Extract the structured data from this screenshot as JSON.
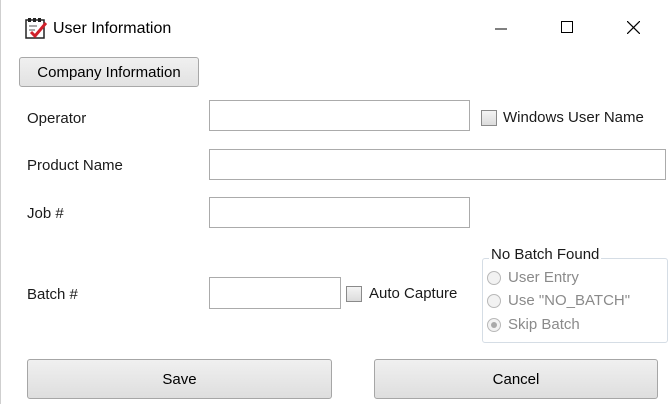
{
  "window": {
    "title": "User Information",
    "controls": {
      "minimize": "minimize",
      "maximize": "maximize",
      "close": "close"
    }
  },
  "company_button": {
    "label": "Company Information"
  },
  "operator": {
    "label": "Operator",
    "value": "",
    "windows_user_name": {
      "label": "Windows User Name",
      "checked": false
    }
  },
  "product_name": {
    "label": "Product Name",
    "value": ""
  },
  "job": {
    "label": "Job #",
    "value": ""
  },
  "batch": {
    "label": "Batch #",
    "value": "",
    "auto_capture": {
      "label": "Auto Capture",
      "checked": false
    }
  },
  "no_batch_found": {
    "title": "No Batch Found",
    "options": [
      {
        "label": "User Entry",
        "selected": false,
        "enabled": false
      },
      {
        "label": "Use \"NO_BATCH\"",
        "selected": false,
        "enabled": false
      },
      {
        "label": "Skip Batch",
        "selected": true,
        "enabled": false
      }
    ]
  },
  "actions": {
    "save": "Save",
    "cancel": "Cancel"
  },
  "icons": {
    "app": "checklist-icon"
  }
}
